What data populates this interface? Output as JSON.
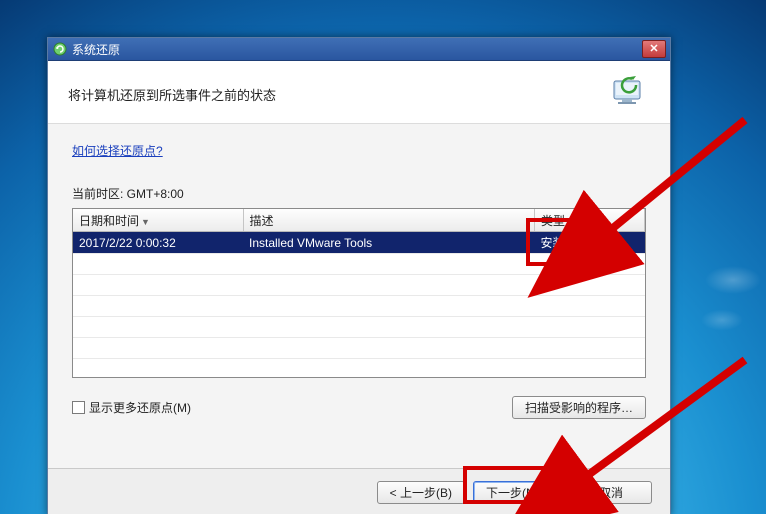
{
  "window": {
    "title": "系统还原",
    "header": "将计算机还原到所选事件之前的状态"
  },
  "body": {
    "how_link": "如何选择还原点?",
    "timezone_label": "当前时区: GMT+8:00"
  },
  "table": {
    "col_datetime": "日期和时间",
    "col_desc": "描述",
    "col_type": "类型",
    "rows": [
      {
        "datetime": "2017/2/22 0:00:32",
        "desc": "Installed VMware Tools",
        "type": "安装"
      }
    ]
  },
  "controls": {
    "show_more_checkbox": "显示更多还原点(M)",
    "scan_button": "扫描受影响的程序…"
  },
  "footer": {
    "back": "< 上一步(B)",
    "next": "下一步(N) >",
    "cancel": "取消"
  }
}
